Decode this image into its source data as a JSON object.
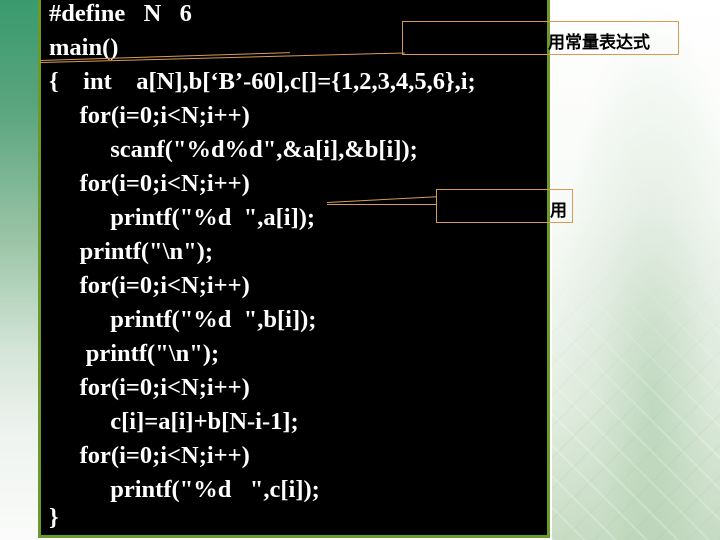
{
  "slide": {
    "code_lines": [
      "#define   N   6",
      "main()",
      "{    int    a[N],b[‘B’-60],c[]={1,2,3,4,5,6},i;",
      "     for(i=0;i<N;i++)",
      "          scanf(\"%d%d\",&a[i],&b[i]);",
      "     for(i=0;i<N;i++)",
      "          printf(\"%d  \",a[i]);",
      "     printf(\"\\n\");",
      "     for(i=0;i<N;i++)",
      "          printf(\"%d  \",b[i]);",
      "      printf(\"\\n\");",
      "     for(i=0;i<N;i++)",
      "          c[i]=a[i]+b[N-i-1];",
      "     for(i=0;i<N;i++)",
      "          printf(\"%d   \",c[i]);",
      "}"
    ],
    "callouts": [
      {
        "text": "用常量表达式"
      },
      {
        "text": "用"
      }
    ],
    "colors": {
      "panel_bg": "#000000",
      "panel_border": "#6b9a2a",
      "callout_border": "#d99a55",
      "code_text": "#ffffff"
    }
  }
}
